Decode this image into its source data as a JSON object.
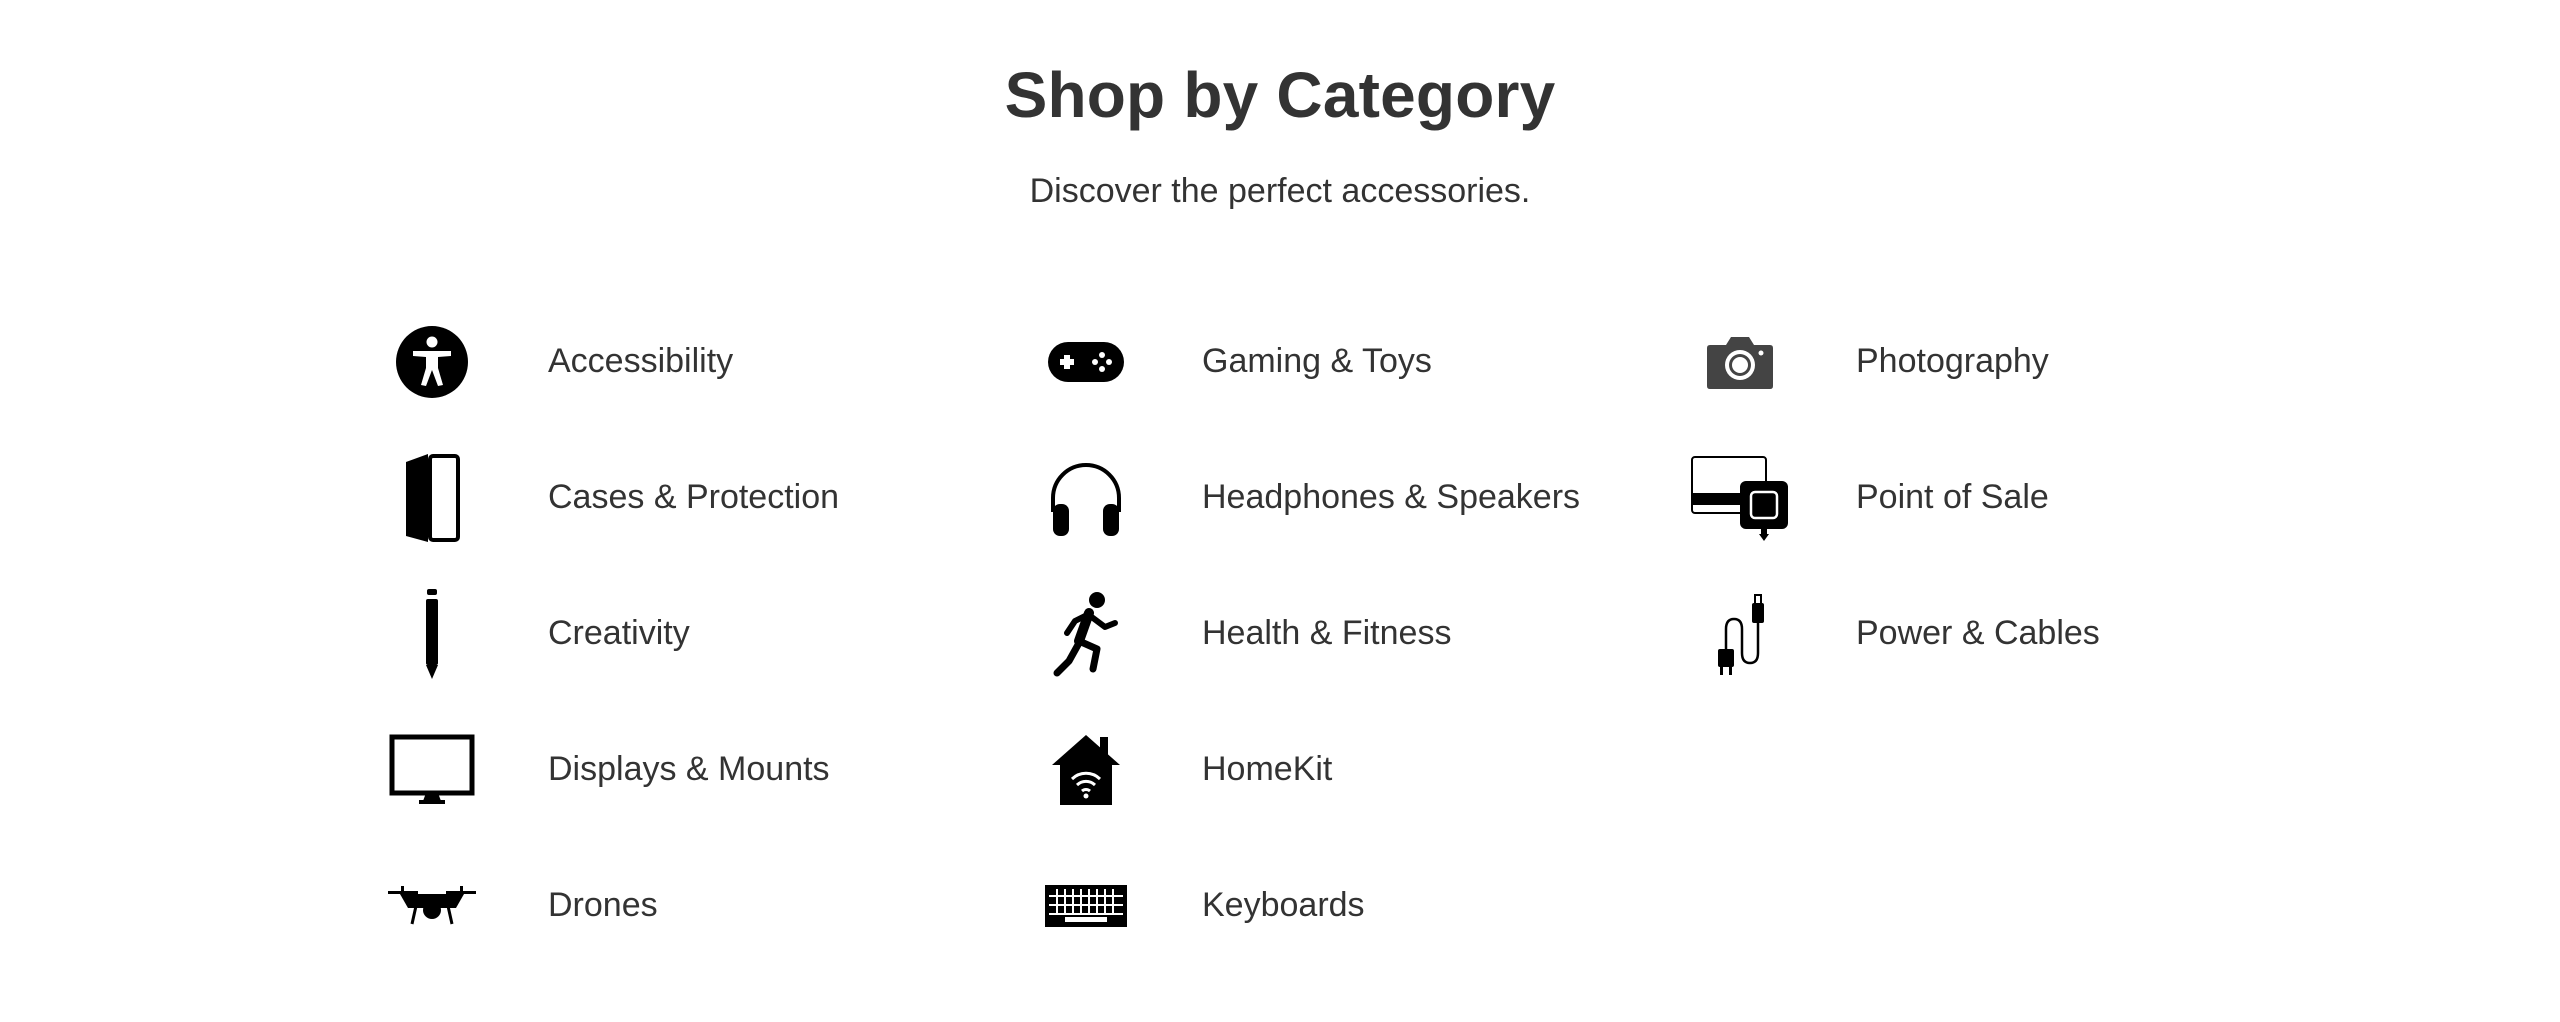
{
  "header": {
    "title": "Shop by Category",
    "subtitle": "Discover the perfect accessories."
  },
  "columns": [
    {
      "items": [
        {
          "label": "Accessibility",
          "icon": "accessibility-icon"
        },
        {
          "label": "Cases & Protection",
          "icon": "case-icon"
        },
        {
          "label": "Creativity",
          "icon": "pencil-icon"
        },
        {
          "label": "Displays & Mounts",
          "icon": "display-icon"
        },
        {
          "label": "Drones",
          "icon": "drone-icon"
        }
      ]
    },
    {
      "items": [
        {
          "label": "Gaming & Toys",
          "icon": "gamepad-icon"
        },
        {
          "label": "Headphones & Speakers",
          "icon": "headphones-icon"
        },
        {
          "label": "Health & Fitness",
          "icon": "runner-icon"
        },
        {
          "label": "HomeKit",
          "icon": "home-icon"
        },
        {
          "label": "Keyboards",
          "icon": "keyboard-icon"
        }
      ]
    },
    {
      "items": [
        {
          "label": "Photography",
          "icon": "camera-icon"
        },
        {
          "label": "Point of Sale",
          "icon": "card-reader-icon"
        },
        {
          "label": "Power & Cables",
          "icon": "power-cable-icon"
        }
      ]
    }
  ]
}
